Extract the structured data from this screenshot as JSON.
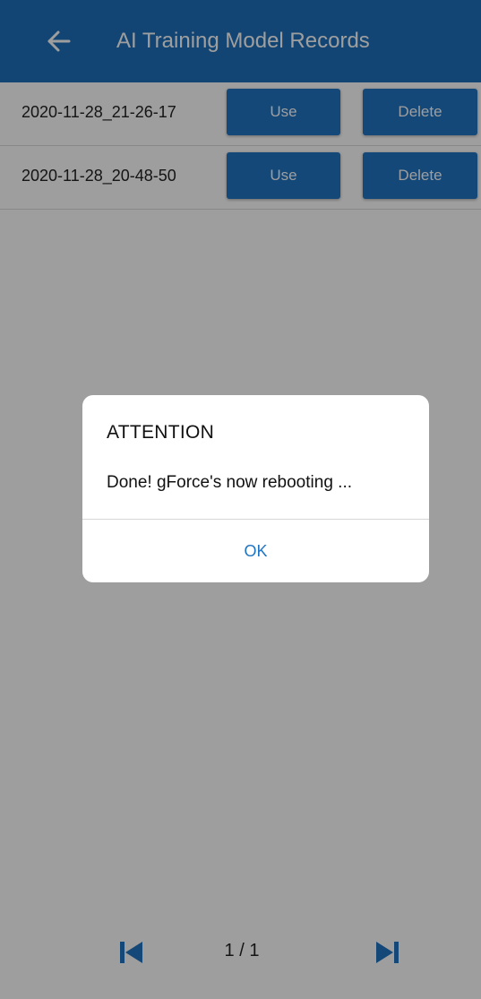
{
  "app_bar": {
    "title": "AI Training Model Records",
    "back_icon": "arrow-left-icon",
    "color": "#1e70bb"
  },
  "records": [
    {
      "name": "2020-11-28_21-26-17",
      "use_label": "Use",
      "delete_label": "Delete"
    },
    {
      "name": "2020-11-28_20-48-50",
      "use_label": "Use",
      "delete_label": "Delete"
    }
  ],
  "pager": {
    "first_icon": "skip-first-icon",
    "last_icon": "skip-last-icon",
    "text": "1 / 1"
  },
  "dialog": {
    "title": "ATTENTION",
    "message": "Done! gForce's now rebooting ...",
    "ok_label": "OK"
  },
  "colors": {
    "accent": "#1f74c4",
    "scrim": "rgba(0,0,0,0.38)"
  }
}
